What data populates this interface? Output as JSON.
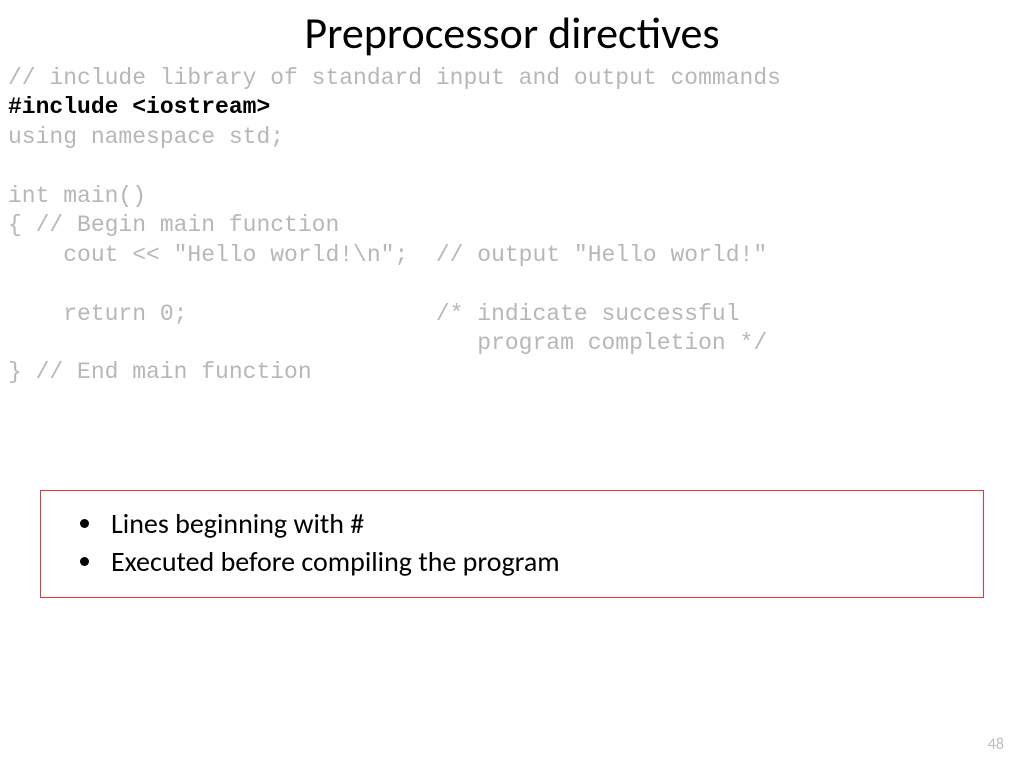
{
  "title": "Preprocessor directives",
  "code": {
    "l1": "// include library of standard input and output commands",
    "l2": "#include <iostream>",
    "l3": "using namespace std;",
    "l4": "",
    "l5": "int main()",
    "l6": "{ // Begin main function",
    "l7": "    cout << \"Hello world!\\n\";  // output \"Hello world!\"",
    "l8": "",
    "l9": "    return 0;                  /* indicate successful",
    "l10": "                                  program completion */",
    "l11": "} // End main function"
  },
  "bullets": {
    "b1": "Lines beginning with #",
    "b2": "Executed before compiling the program"
  },
  "page_number": "48"
}
